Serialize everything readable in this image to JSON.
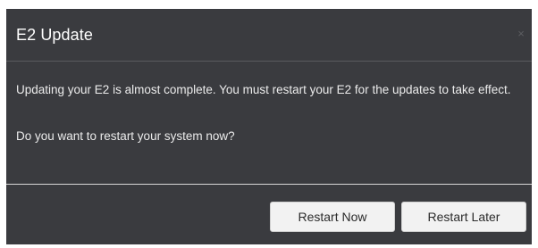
{
  "dialog": {
    "title": "E2 Update",
    "close_glyph": "×",
    "messages": [
      "Updating your E2 is almost complete. You must restart your E2 for the updates to take effect.",
      "Do you want to restart your system now?"
    ],
    "buttons": {
      "restart_now": "Restart Now",
      "restart_later": "Restart Later"
    }
  },
  "colors": {
    "dialog_background": "#3a3b3f",
    "button_background": "#f2f2f2",
    "text": "#ececec"
  }
}
